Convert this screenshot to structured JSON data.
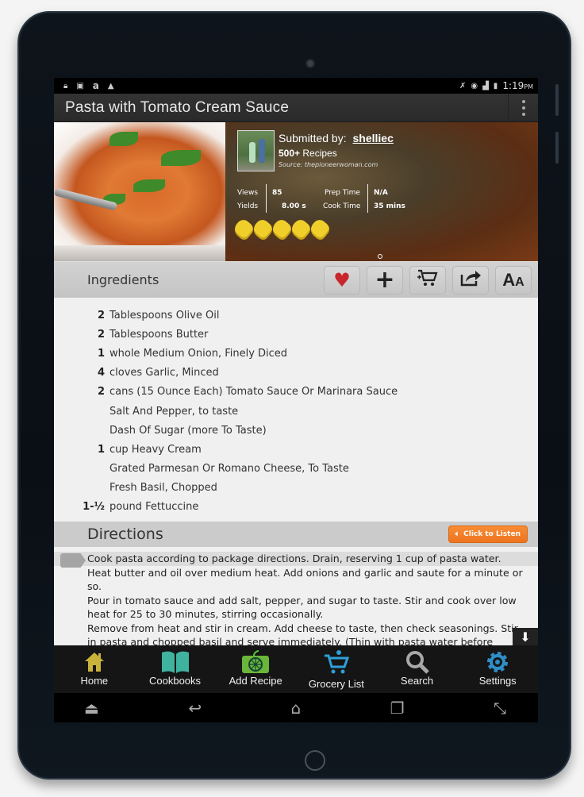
{
  "status_bar": {
    "left_icons": [
      "lock-icon",
      "image-icon",
      "amazon-icon",
      "warning-icon"
    ],
    "right_icons": [
      "mute-icon",
      "wifi-icon",
      "signal-icon",
      "battery-icon"
    ],
    "time": "1:19",
    "ampm": "PM"
  },
  "action_bar": {
    "title": "Pasta with Tomato Cream Sauce",
    "overflow_icon": "overflow-menu-icon"
  },
  "recipe": {
    "submitted_by_label": "Submitted by:",
    "author": "shelliec",
    "recipes_count": "500+",
    "recipes_label": "Recipes",
    "source": "Source: thepioneerwoman.com",
    "stats": {
      "views_label": "Views",
      "views_value": "85",
      "yields_label": "Yields",
      "yields_value": "8.00 s",
      "prep_label": "Prep Time",
      "prep_value": "N/A",
      "cook_label": "Cook Time",
      "cook_value": "35 mins"
    },
    "rating": 5,
    "rating_max": 5
  },
  "ingredients": {
    "header": "Ingredients",
    "tools": [
      {
        "name": "favorite",
        "icon": "heart-icon",
        "glyph": "♥"
      },
      {
        "name": "add",
        "icon": "plus-icon",
        "glyph": "+"
      },
      {
        "name": "add-to-cart",
        "icon": "cart-icon",
        "glyph": "🛒"
      },
      {
        "name": "share",
        "icon": "share-icon",
        "glyph": "➦"
      },
      {
        "name": "text-size",
        "icon": "font-size-icon",
        "glyph": "AA"
      }
    ],
    "items": [
      {
        "qty": "2",
        "text": "Tablespoons Olive Oil"
      },
      {
        "qty": "2",
        "text": "Tablespoons Butter"
      },
      {
        "qty": "1",
        "text": "whole Medium Onion, Finely Diced"
      },
      {
        "qty": "4",
        "text": "cloves Garlic, Minced"
      },
      {
        "qty": "2",
        "text": "cans (15 Ounce Each) Tomato Sauce Or Marinara Sauce"
      },
      {
        "qty": "",
        "text": "Salt And Pepper, to taste"
      },
      {
        "qty": "",
        "text": "Dash Of Sugar (more To Taste)"
      },
      {
        "qty": "1",
        "text": "cup Heavy Cream"
      },
      {
        "qty": "",
        "text": "Grated Parmesan Or Romano Cheese, To Taste"
      },
      {
        "qty": "",
        "text": "Fresh Basil, Chopped"
      },
      {
        "qty": "1-½",
        "text": "pound Fettuccine"
      }
    ]
  },
  "directions": {
    "header": "Directions",
    "listen_label": "Click to Listen",
    "steps": [
      "Cook pasta according to package directions. Drain, reserving 1 cup of pasta water.",
      "Heat butter and oil over medium heat. Add onions and garlic and saute for a minute or so.",
      "Pour in tomato sauce and add salt, pepper, and sugar to taste. Stir and cook over low heat for 25 to 30 minutes, stirring occasionally.",
      "Remove from heat and stir in cream. Add cheese to taste, then check seasonings. Stir in pasta and chopped basil and serve immediately. (Thin with pasta water before adding basil if needed.)"
    ]
  },
  "tabbar": [
    {
      "label": "Home",
      "icon": "home-icon",
      "color": "#c9b23a"
    },
    {
      "label": "Cookbooks",
      "icon": "book-icon",
      "color": "#3fb3a0"
    },
    {
      "label": "Add Recipe",
      "icon": "add-recipe-icon",
      "color": "#6bb53a"
    },
    {
      "label": "Grocery List",
      "icon": "grocery-cart-icon",
      "color": "#2e9fd8"
    },
    {
      "label": "Search",
      "icon": "search-icon",
      "color": "#a8a8a8"
    },
    {
      "label": "Settings",
      "icon": "gear-icon",
      "color": "#2e8fc8"
    }
  ],
  "navbar": [
    "hide-keyboard-icon",
    "back-icon",
    "home-nav-icon",
    "recent-apps-icon",
    "fullscreen-icon"
  ],
  "colors": {
    "accent_orange": "#f07a24",
    "heart_red": "#c8262a",
    "rating_yellow": "#f1cf2a"
  }
}
